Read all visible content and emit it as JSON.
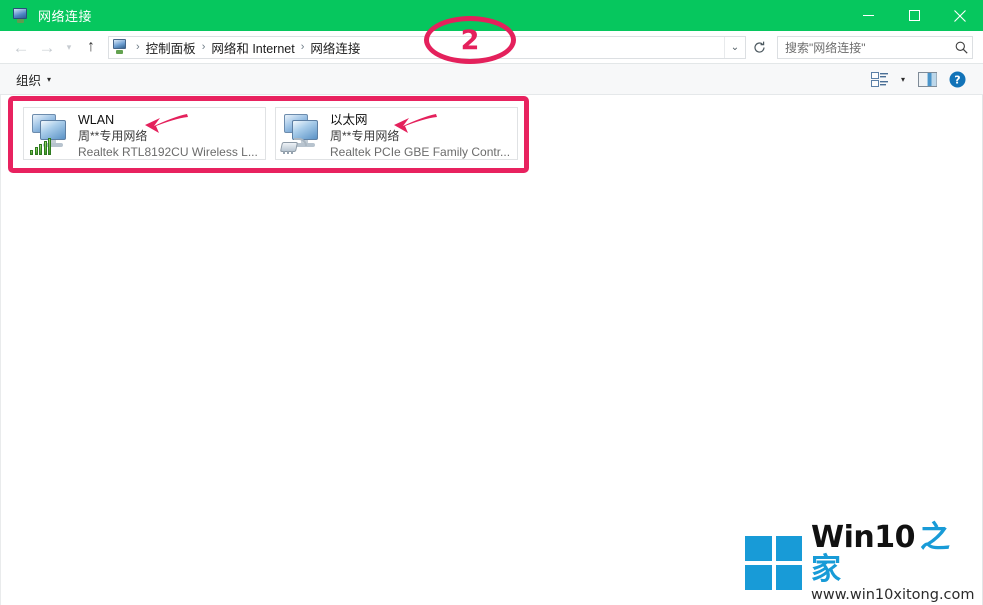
{
  "window": {
    "title": "网络连接",
    "title_icon": "network-connections-icon",
    "minimize_label": "最小化",
    "maximize_label": "最大化",
    "close_label": "关闭",
    "titlebar_color": "#06c75e"
  },
  "navbar": {
    "back_label": "后退",
    "forward_label": "前进",
    "recent_label": "最近浏览的位置",
    "up_label": "上移到“网络和 Internet”",
    "breadcrumbs": [
      "控制面板",
      "网络和 Internet",
      "网络连接"
    ],
    "separator": "›",
    "chevron": "⌄",
    "refresh_label": "刷新",
    "search": {
      "placeholder": "搜索\"网络连接\"",
      "value": ""
    }
  },
  "toolbar": {
    "organize_label": "组织",
    "caret": "▾",
    "view_icon": "change-view-icon",
    "view_caret": "▾",
    "preview_icon": "preview-pane-icon",
    "help_icon": "help-icon"
  },
  "connections": [
    {
      "name": "WLAN",
      "network": "周**专用网络",
      "device": "Realtek RTL8192CU Wireless L...",
      "adapter_type": "wireless"
    },
    {
      "name": "以太网",
      "network": "周**专用网络",
      "device": "Realtek PCIe GBE Family Contr...",
      "adapter_type": "ethernet"
    }
  ],
  "annotations": {
    "step_number": "2",
    "accent_color": "#e8225f",
    "highlight_label": "网络适配器列表高亮框",
    "circle_label": "步骤标记 2",
    "arrow_label": "指示箭头"
  },
  "watermark": {
    "brand_latin": "Win10",
    "brand_cn": "之家",
    "url": "www.win10xitong.com",
    "logo_color": "#189bd7"
  }
}
